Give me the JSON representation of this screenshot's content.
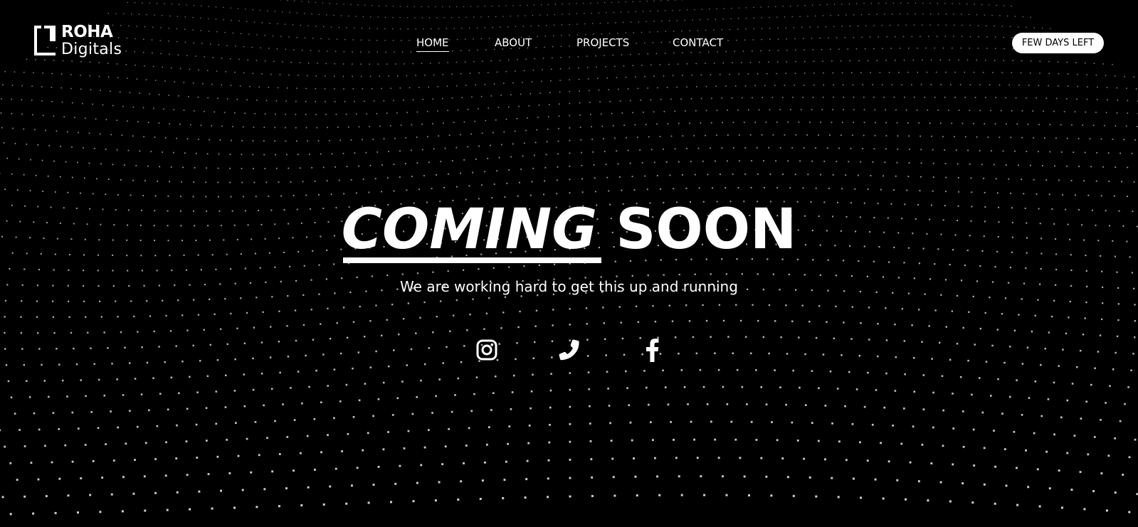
{
  "brand": {
    "name_top": "ROHA",
    "name_bottom": "Digitals"
  },
  "nav": {
    "items": [
      {
        "label": "HOME",
        "active": true
      },
      {
        "label": "ABOUT",
        "active": false
      },
      {
        "label": "PROJECTS",
        "active": false
      },
      {
        "label": "CONTACT",
        "active": false
      }
    ]
  },
  "badge": {
    "label": "FEW DAYS LEFT"
  },
  "hero": {
    "title_part1": "COMING",
    "title_part2": "SOON",
    "subtitle": "We are working hard to get this up and running"
  },
  "social": {
    "icons": [
      "instagram-icon",
      "phone-icon",
      "facebook-icon"
    ]
  },
  "colors": {
    "background": "#000000",
    "foreground": "#ffffff",
    "badge_bg": "#ffffff",
    "badge_text": "#000000"
  }
}
